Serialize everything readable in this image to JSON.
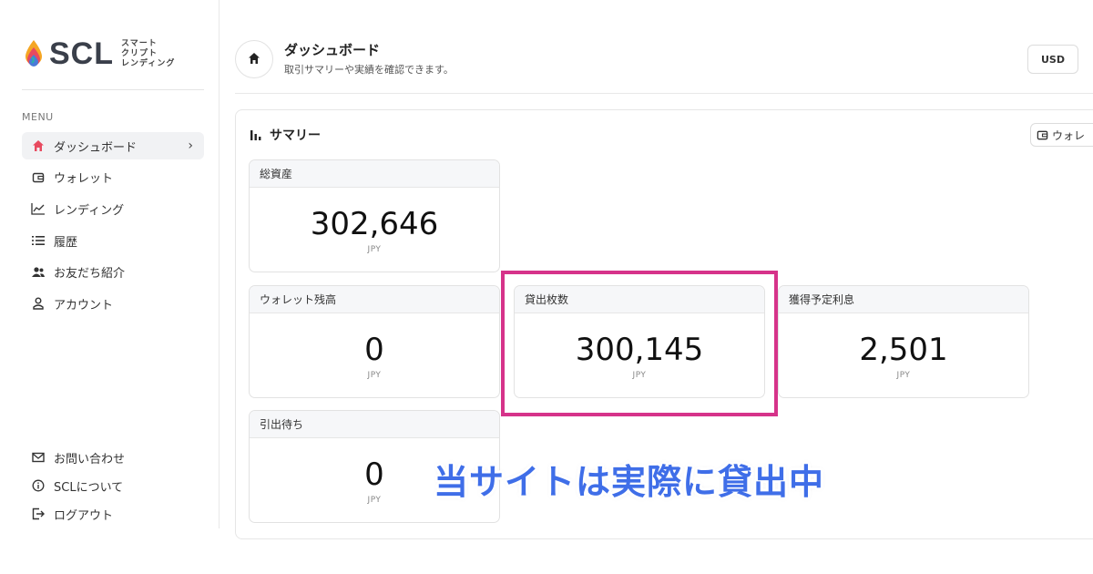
{
  "brand": {
    "name": "SCL",
    "sub_lines": [
      "スマート",
      "クリプト",
      "レンディング"
    ]
  },
  "sidebar": {
    "menu_label": "MENU",
    "items": [
      {
        "label": "ダッシュボード",
        "icon": "home-icon",
        "active": true
      },
      {
        "label": "ウォレット",
        "icon": "wallet-icon"
      },
      {
        "label": "レンディング",
        "icon": "chart-line-icon"
      },
      {
        "label": "履歴",
        "icon": "list-icon"
      },
      {
        "label": "お友だち紹介",
        "icon": "group-icon"
      },
      {
        "label": "アカウント",
        "icon": "person-icon"
      }
    ],
    "bottom_items": [
      {
        "label": "お問い合わせ",
        "icon": "mail-icon"
      },
      {
        "label": "SCLについて",
        "icon": "info-icon"
      },
      {
        "label": "ログアウト",
        "icon": "logout-icon"
      }
    ]
  },
  "header": {
    "title": "ダッシュボード",
    "subtitle": "取引サマリーや実績を確認できます。",
    "currency": "USD"
  },
  "summary": {
    "title": "サマリー",
    "wallet_button": "ウォレ",
    "cards": {
      "total_assets": {
        "label": "総資産",
        "value": "302,646",
        "unit": "JPY"
      },
      "wallet_balance": {
        "label": "ウォレット残高",
        "value": "0",
        "unit": "JPY"
      },
      "lent_amount": {
        "label": "貸出枚数",
        "value": "300,145",
        "unit": "JPY"
      },
      "expected_interest": {
        "label": "獲得予定利息",
        "value": "2,501",
        "unit": "JPY"
      },
      "pending_withdrawal": {
        "label": "引出待ち",
        "value": "0",
        "unit": "JPY"
      }
    }
  },
  "overlay": {
    "caption": "当サイトは実際に貸出中",
    "highlight_color": "#d6338a",
    "caption_color": "#3f6ee8"
  },
  "colors": {
    "accent_red": "#e84a5f",
    "logo_teal": "#2ab3a6",
    "logo_blue": "#4a7bd8"
  }
}
